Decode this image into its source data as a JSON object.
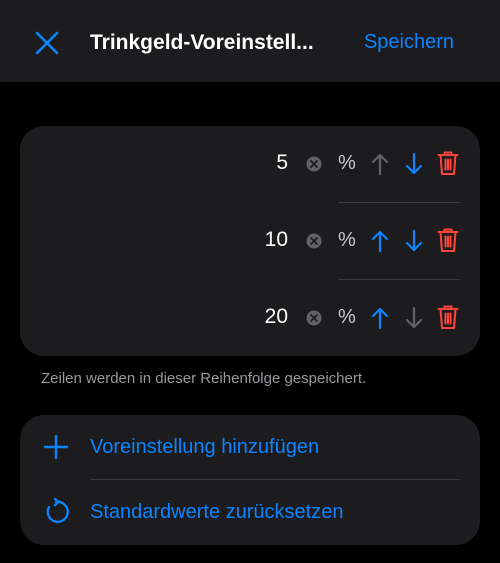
{
  "navbar": {
    "title": "Trinkgeld-Voreinstell...",
    "save_label": "Speichern"
  },
  "presets": [
    {
      "value": "5",
      "unit": "%"
    },
    {
      "value": "10",
      "unit": "%"
    },
    {
      "value": "20",
      "unit": "%"
    }
  ],
  "footer_note": "Zeilen werden in dieser Reihenfolge gespeichert.",
  "actions": {
    "add_label": "Voreinstellung hinzufügen",
    "reset_label": "Standardwerte zurücksetzen"
  },
  "colors": {
    "accent": "#0a84ff",
    "destructive": "#ff453a",
    "disabled": "#636366",
    "background": "#000000",
    "card": "#1c1c1e"
  }
}
